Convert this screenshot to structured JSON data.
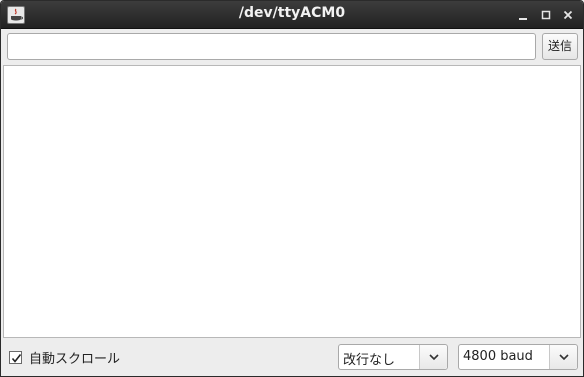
{
  "window": {
    "title": "/dev/ttyACM0",
    "icon": "java-app-icon",
    "controls": [
      "minimize-icon",
      "maximize-icon",
      "close-icon"
    ]
  },
  "toolbar": {
    "input_value": "",
    "input_placeholder": "",
    "send_label": "送信"
  },
  "output": {
    "text": ""
  },
  "statusbar": {
    "autoscroll_label": "自動スクロール",
    "autoscroll_checked": true,
    "line_ending": {
      "selected": "改行なし"
    },
    "baud_rate": {
      "selected": "4800 baud"
    }
  }
}
